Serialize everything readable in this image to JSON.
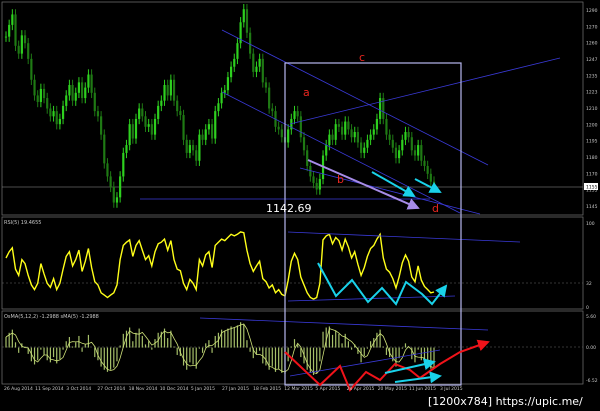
{
  "chart_data": {
    "type": "line",
    "colors": {
      "background": "#000000",
      "bull": "#2ed11f",
      "bear": "#1f7a14",
      "rsi": "#ffff19",
      "osma": "#a6c06a",
      "trendline": "#3a3ad8",
      "highlight_box": "#b7b8f0",
      "wave_label": "#e8261f",
      "cyan_arrow": "#19d2ea",
      "violet_arrow": "#a78ce8",
      "red_arrow": "#f0131a"
    },
    "price_pane": {
      "yticks": [
        "1290",
        "1270",
        "1260",
        "1247",
        "1235",
        "1223",
        "1210",
        "1200",
        "1195",
        "1180",
        "1170",
        "1155",
        "1145"
      ],
      "last_price": "1155",
      "annotation": "1142.69",
      "wave_labels": [
        "a",
        "b",
        "c",
        "d"
      ]
    },
    "rsi_pane": {
      "title": "RSI(5) 19.4655",
      "yticks": [
        "100",
        "32",
        "0"
      ]
    },
    "osma_pane": {
      "title": "OsMA(5,12,2) -1.2988   sMA(5) -1.2988",
      "yticks": [
        "5.60",
        "0.00",
        "-6.52"
      ]
    },
    "xticks": [
      "26 Aug 2014",
      "11 Sep 2014",
      "3 Oct 2014",
      "27 Oct 2014",
      "18 Nov 2014",
      "10 Dec 2014",
      "5 Jan 2015",
      "27 Jan 2015",
      "18 Feb 2015",
      "12 Mar 2015",
      "5 Apr 2015",
      "28 Apr 2015",
      "20 May 2015",
      "11 Jun 2015",
      "3 Jul 2015"
    ],
    "series": [
      {
        "values": [
          1275,
          1284,
          1292,
          1268,
          1262,
          1276,
          1270,
          1258,
          1242,
          1230,
          1225,
          1235,
          1228,
          1220,
          1214,
          1218,
          1208,
          1212,
          1222,
          1230,
          1238,
          1226,
          1232,
          1240,
          1228,
          1236,
          1246,
          1232,
          1218,
          1214,
          1200,
          1178,
          1168,
          1160,
          1148,
          1152,
          1168,
          1186,
          1192,
          1208,
          1197,
          1212,
          1220,
          1214,
          1206,
          1208,
          1200,
          1212,
          1222,
          1226,
          1238,
          1230,
          1242,
          1226,
          1218,
          1215,
          1196,
          1186,
          1192,
          1188,
          1180,
          1200,
          1196,
          1204,
          1208,
          1197,
          1218,
          1224,
          1232,
          1234,
          1244,
          1252,
          1258,
          1270,
          1286,
          1296,
          1278,
          1262,
          1248,
          1252,
          1258,
          1240,
          1236,
          1220,
          1218,
          1206,
          1204,
          1198,
          1194,
          1204,
          1212,
          1218,
          1214,
          1198,
          1188,
          1176,
          1168,
          1163,
          1158,
          1166,
          1184,
          1192,
          1200,
          1196,
          1208,
          1206,
          1200,
          1210,
          1204,
          1198,
          1202,
          1194,
          1186,
          1190,
          1196,
          1200,
          1204,
          1212,
          1228,
          1212,
          1200,
          1196,
          1190,
          1182,
          1188,
          1196,
          1202,
          1198,
          1188,
          1184,
          1192,
          1180,
          1176,
          1170,
          1164,
          1160
        ]
      },
      {
        "values": [
          62,
          70,
          75,
          48,
          40,
          60,
          55,
          40,
          28,
          22,
          30,
          55,
          42,
          30,
          25,
          36,
          22,
          30,
          48,
          64,
          70,
          52,
          60,
          72,
          45,
          58,
          74,
          50,
          32,
          28,
          18,
          15,
          12,
          15,
          18,
          28,
          60,
          78,
          82,
          85,
          64,
          78,
          84,
          72,
          60,
          65,
          52,
          70,
          80,
          82,
          86,
          72,
          84,
          60,
          48,
          46,
          30,
          22,
          35,
          30,
          22,
          60,
          52,
          66,
          70,
          50,
          78,
          82,
          86,
          84,
          88,
          92,
          90,
          92,
          95,
          94,
          72,
          55,
          45,
          52,
          58,
          36,
          32,
          24,
          28,
          18,
          22,
          16,
          14,
          34,
          58,
          68,
          60,
          38,
          28,
          18,
          12,
          10,
          12,
          30,
          85,
          90,
          92,
          80,
          88,
          84,
          72,
          86,
          76,
          62,
          70,
          54,
          40,
          50,
          64,
          74,
          78,
          86,
          92,
          62,
          48,
          44,
          36,
          24,
          38,
          56,
          66,
          58,
          38,
          32,
          52,
          34,
          26,
          22,
          18,
          19
        ]
      },
      {
        "values": [
          2.0,
          2.8,
          3.4,
          1.0,
          -1.0,
          0.8,
          0.2,
          -1.2,
          -2.6,
          -3.2,
          -2.4,
          -0.4,
          -1.4,
          -2.4,
          -2.8,
          -1.8,
          -3.0,
          -2.2,
          -0.4,
          1.2,
          2.0,
          0.2,
          1.0,
          2.2,
          -0.8,
          0.6,
          2.4,
          0.0,
          -1.8,
          -2.4,
          -3.6,
          -4.2,
          -4.6,
          -4.2,
          -3.8,
          -2.6,
          0.4,
          2.6,
          3.2,
          3.8,
          1.2,
          2.8,
          3.6,
          2.2,
          0.6,
          1.2,
          -0.4,
          1.6,
          2.8,
          3.0,
          3.6,
          1.8,
          3.2,
          0.2,
          -1.4,
          -1.6,
          -3.4,
          -4.2,
          -2.8,
          -3.2,
          -4.0,
          -0.2,
          -1.0,
          0.8,
          1.4,
          -1.0,
          2.2,
          2.8,
          3.4,
          3.2,
          3.6,
          4.0,
          3.8,
          4.2,
          4.8,
          4.4,
          1.4,
          -0.8,
          -2.0,
          -1.2,
          -0.6,
          -3.0,
          -3.4,
          -4.2,
          -3.6,
          -4.6,
          -4.0,
          -4.8,
          -5.0,
          -2.6,
          0.2,
          1.6,
          0.6,
          -1.8,
          -3.0,
          -4.2,
          -4.8,
          -5.2,
          -4.8,
          -2.6,
          3.0,
          3.8,
          4.0,
          2.4,
          3.2,
          2.6,
          0.8,
          2.6,
          1.2,
          -0.4,
          0.6,
          -1.2,
          -2.8,
          -1.6,
          -0.2,
          1.2,
          1.8,
          2.8,
          3.4,
          0.2,
          -1.4,
          -1.8,
          -2.6,
          -3.6,
          -2.0,
          -0.2,
          0.8,
          0.0,
          -2.2,
          -2.8,
          -0.4,
          -2.4,
          -3.2,
          -3.6,
          -4.0,
          -3.8
        ]
      }
    ]
  },
  "footer": {
    "watermark": "[1200x784] https://upic.me/"
  }
}
